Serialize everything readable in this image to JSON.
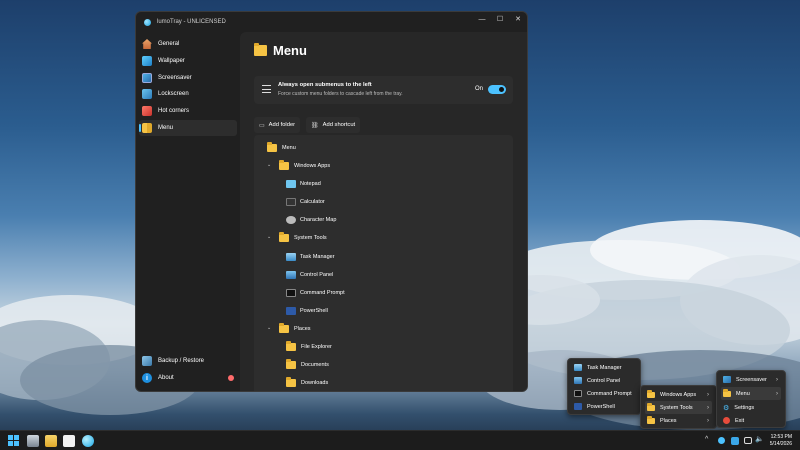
{
  "window": {
    "title": "lumoTray - UNLICENSED",
    "controls": {
      "minimize": "—",
      "maximize": "☐",
      "close": "✕"
    }
  },
  "sidebar": {
    "items": [
      {
        "label": "General",
        "icon": "home-icon"
      },
      {
        "label": "Wallpaper",
        "icon": "wallpaper-icon"
      },
      {
        "label": "Screensaver",
        "icon": "screensaver-icon"
      },
      {
        "label": "Lockscreen",
        "icon": "lockscreen-icon"
      },
      {
        "label": "Hot corners",
        "icon": "hot-corners-icon"
      },
      {
        "label": "Menu",
        "icon": "menu-folder-icon",
        "active": true
      }
    ],
    "bottom": [
      {
        "label": "Backup / Restore",
        "icon": "backup-icon"
      },
      {
        "label": "About",
        "icon": "info-icon"
      }
    ]
  },
  "page": {
    "title": "Menu",
    "setting": {
      "title": "Always open submenus to the left",
      "description": "Force custom menu folders to cascade left from the tray.",
      "toggle_label": "On",
      "toggle_on": true
    },
    "buttons": {
      "add_folder": "Add folder",
      "add_shortcut": "Add shortcut"
    },
    "tree": {
      "root": "Menu",
      "groups": [
        {
          "label": "Windows Apps",
          "items": [
            "Notepad",
            "Calculator",
            "Character Map"
          ]
        },
        {
          "label": "System Tools",
          "items": [
            "Task Manager",
            "Control Panel",
            "Command Prompt",
            "PowerShell"
          ]
        },
        {
          "label": "Places",
          "items": [
            "File Explorer",
            "Documents",
            "Downloads"
          ]
        }
      ]
    }
  },
  "tray_menu": {
    "main": [
      "Screensaver",
      "Menu",
      "Settings",
      "Exit"
    ],
    "sub": [
      "Windows Apps",
      "System Tools",
      "Places"
    ],
    "subsub": [
      "Task Manager",
      "Control Panel",
      "Command Prompt",
      "PowerShell"
    ]
  },
  "taskbar": {
    "time": "12:53 PM",
    "date": "5/14/2026",
    "chevron": "^"
  },
  "colors": {
    "accent": "#4cc2ff",
    "folder": "#f5c344",
    "window_bg": "#202020"
  }
}
